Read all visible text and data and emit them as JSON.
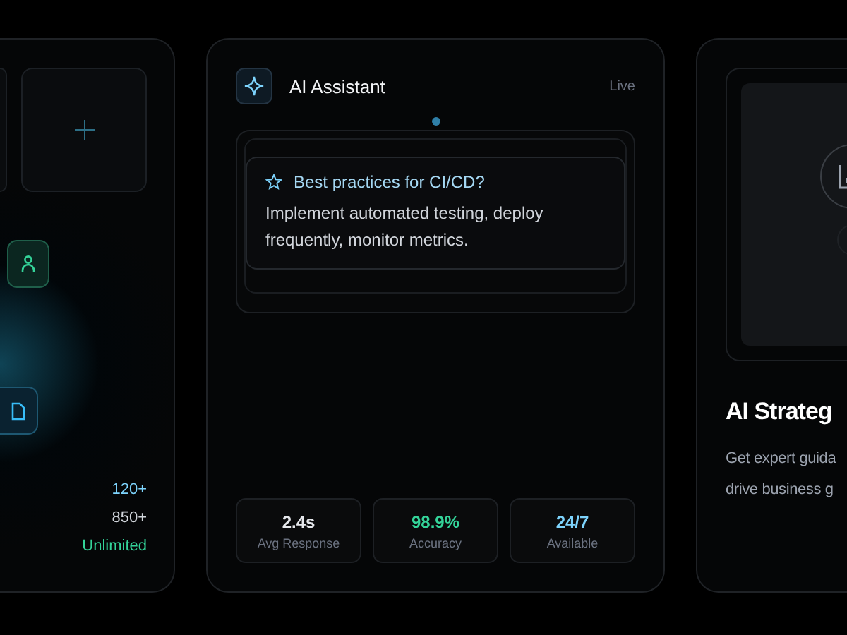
{
  "left_card": {
    "stats": [
      {
        "value": "120+",
        "kind": "blue"
      },
      {
        "value": "850+",
        "kind": "plain"
      },
      {
        "value": "Unlimited",
        "kind": "green"
      }
    ]
  },
  "assistant_card": {
    "title": "AI Assistant",
    "status": "Live",
    "message": {
      "question": "Best practices for CI/CD?",
      "answer": "Implement automated testing, deploy frequently, monitor metrics."
    },
    "stats": [
      {
        "value": "2.4s",
        "label": "Avg Response",
        "kind": "plain"
      },
      {
        "value": "98.9%",
        "label": "Accuracy",
        "kind": "green"
      },
      {
        "value": "24/7",
        "label": "Available",
        "kind": "blue"
      }
    ]
  },
  "strategy_card": {
    "title": "AI Strateg",
    "description_lines": [
      "Get expert guida",
      "drive business g"
    ]
  }
}
